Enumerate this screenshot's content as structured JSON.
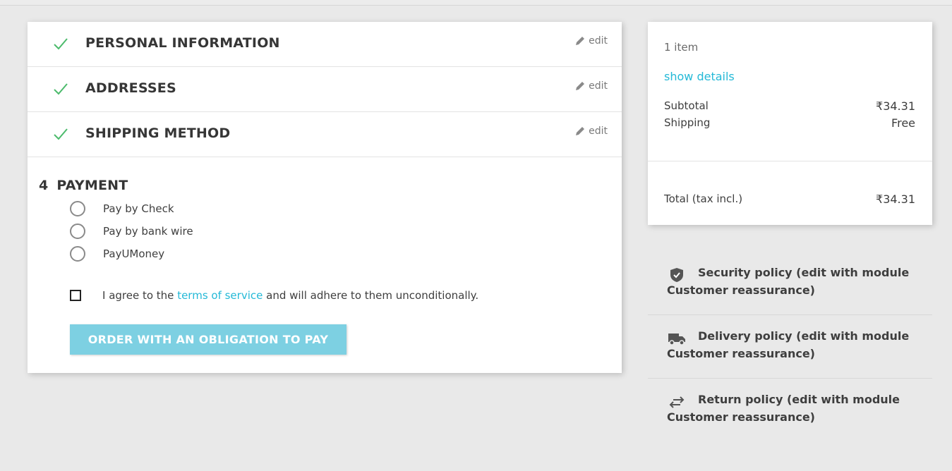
{
  "steps": [
    {
      "title": "PERSONAL INFORMATION",
      "edit_label": "edit"
    },
    {
      "title": "ADDRESSES",
      "edit_label": "edit"
    },
    {
      "title": "SHIPPING METHOD",
      "edit_label": "edit"
    }
  ],
  "payment": {
    "number": "4",
    "title": "PAYMENT",
    "options": [
      "Pay by Check",
      "Pay by bank wire",
      "PayUMoney"
    ],
    "agree_prefix": "I agree to the ",
    "agree_link": "terms of service",
    "agree_suffix": " and will adhere to them unconditionally.",
    "order_button": "ORDER WITH AN OBLIGATION TO PAY"
  },
  "summary": {
    "item_count": "1 item",
    "show_details": "show details",
    "subtotal_label": "Subtotal",
    "subtotal_value": "₹34.31",
    "shipping_label": "Shipping",
    "shipping_value": "Free",
    "total_label": "Total (tax incl.)",
    "total_value": "₹34.31"
  },
  "reassurance": [
    {
      "icon": "shield-icon",
      "text": "Security policy (edit with module Customer reassurance)"
    },
    {
      "icon": "truck-icon",
      "text": "Delivery policy (edit with module Customer reassurance)"
    },
    {
      "icon": "swap-arrows-icon",
      "text": "Return policy (edit with module Customer reassurance)"
    }
  ],
  "colors": {
    "accent": "#24b9d7",
    "check_green": "#4cbb6c",
    "button_bg": "#7dd0e2",
    "page_bg": "#e9e9e9"
  }
}
